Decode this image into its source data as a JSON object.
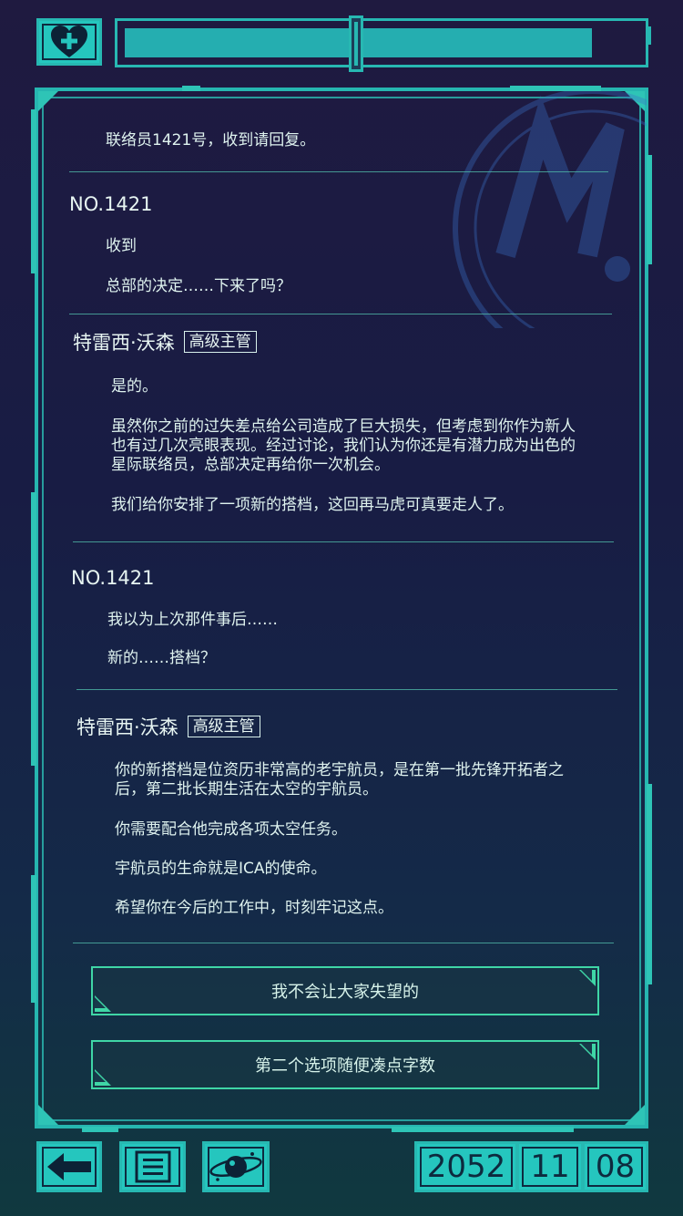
{
  "top": {
    "heart_icon": "heart-plus-icon",
    "progress_fraction": 0.91,
    "knob_fraction": 0.45
  },
  "dialog": {
    "partial_top_text": "联络员1421号，收到请回复。",
    "blocks": [
      {
        "speaker": "NO.1421",
        "badge": "",
        "lines": [
          "收到",
          "总部的决定……下来了吗？"
        ]
      },
      {
        "speaker": "特雷西·沃森",
        "badge": "高级主管",
        "lines": [
          "是的。",
          "虽然你之前的过失差点给公司造成了巨大损失，但考虑到你作为新人也有过几次亮眼表现。经过讨论，我们认为你还是有潜力成为出色的星际联络员，总部决定再给你一次机会。",
          "我们给你安排了一项新的搭档，这回再马虎可真要走人了。"
        ]
      },
      {
        "speaker": "NO.1421",
        "badge": "",
        "lines": [
          "我以为上次那件事后……",
          "新的……搭档？"
        ]
      },
      {
        "speaker": "特雷西·沃森",
        "badge": "高级主管",
        "lines": [
          "你的新搭档是位资历非常高的老宇航员，是在第一批先锋开拓者之后，第二批长期生活在太空的宇航员。",
          "你需要配合他完成各项太空任务。",
          "宇航员的生命就是ICA的使命。",
          "希望你在今后的工作中，时刻牢记这点。"
        ]
      }
    ]
  },
  "choices": [
    {
      "label": "我不会让大家失望的"
    },
    {
      "label": "第二个选项随便凑点字数"
    }
  ],
  "bottom": {
    "back_icon": "back-arrow-icon",
    "menu_icon": "menu-list-icon",
    "planet_icon": "planet-icon",
    "date": {
      "year": "2052",
      "month": "11",
      "day": "08"
    }
  },
  "colors": {
    "accent": "#25c6be",
    "choice_border": "#3fd6a6",
    "background_top": "#1f1a40",
    "background_bottom": "#10393f"
  }
}
